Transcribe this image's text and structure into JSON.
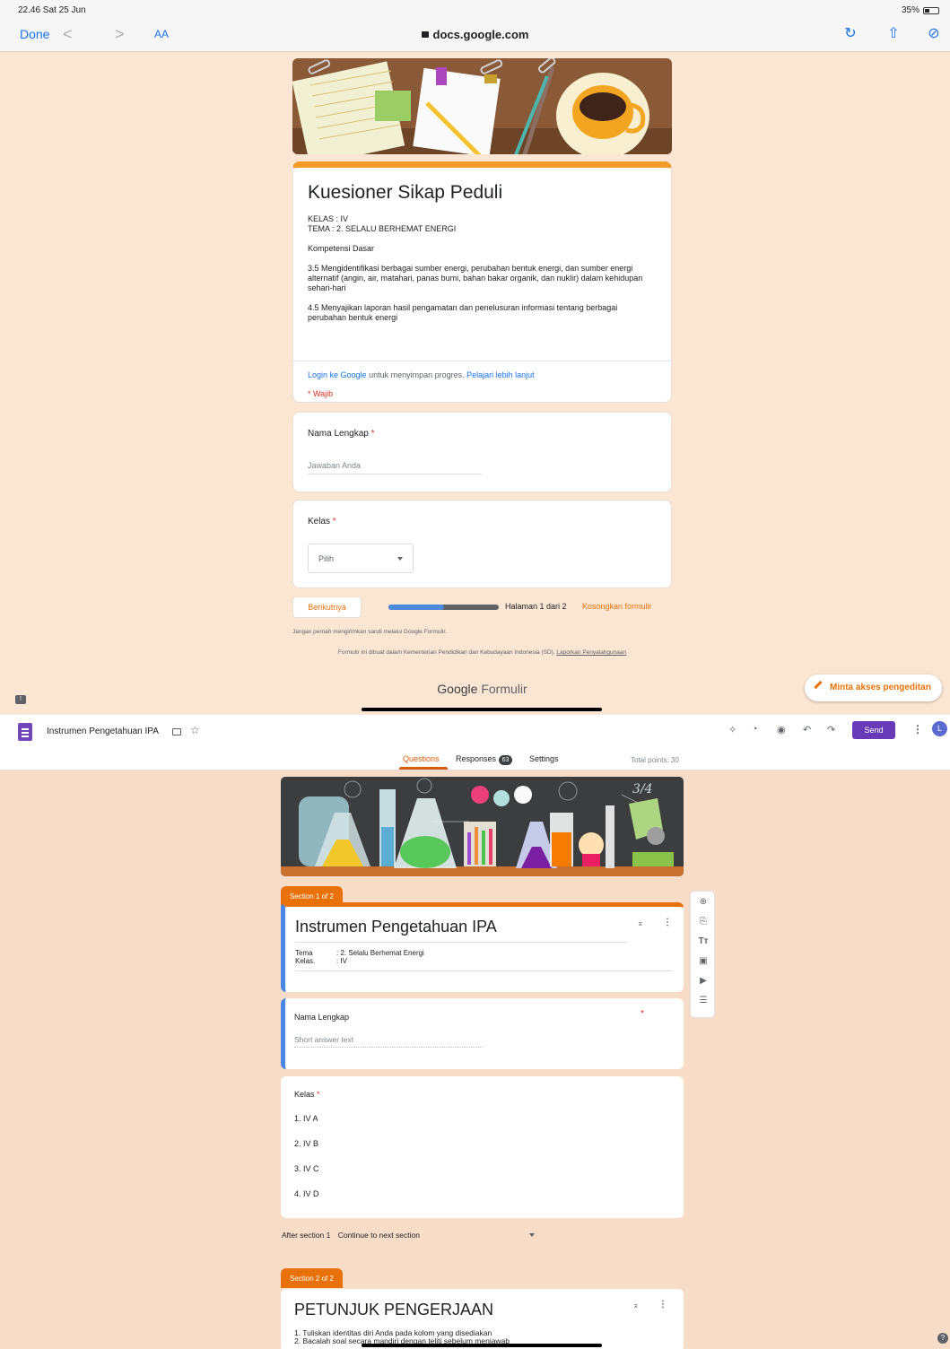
{
  "status_bar": {
    "time": "22.46  Sat 25 Jun",
    "battery": "35%"
  },
  "browser": {
    "done_label": "Done",
    "back": "<",
    "forward": ">",
    "text_size": "AA",
    "url": "docs.google.com"
  },
  "form": {
    "title": "Kuesioner Sikap Peduli",
    "description": "KELAS : IV\nTEMA  : 2. SELALU BERHEMAT ENERGI\n\nKompetensi Dasar\n\n3.5 Mengidentifikasi berbagai sumber energi, perubahan bentuk energi, dan sumber energi alternatif (angin, air, matahari, panas bumi, bahan bakar organik, dan nuklir) dalam kehidupan sehari-hari\n\n4.5  Menyajikan laporan hasil pengamatan dan penelusuran informasi tentang berbagai perubahan bentuk energi",
    "login_link": "Login ke Google",
    "login_text": " untuk menyimpan progres. ",
    "learn_more": "Pelajari lebih lanjut",
    "required_note": "* Wajib",
    "questions": [
      {
        "label": "Nama Lengkap",
        "required_mark": "*",
        "placeholder": "Jawaban Anda"
      },
      {
        "label": "Kelas",
        "required_mark": "*",
        "select_value": "Pilih"
      }
    ],
    "next_button": "Berikutnya",
    "progress_fraction": 0.5,
    "page_text": "Halaman 1 dari 2",
    "clear_form": "Kosongkan formulir",
    "footnote_password": "Jangan pernah mengirimkan sandi melalui Google Formulir.",
    "footnote_org": "Formulir ini dibuat dalam Kementerian Pendidikan dan Kebudayaan Indonesia (SD). ",
    "footnote_report": "Laporkan Penyalahgunaan",
    "brand_google": "Google",
    "brand_formulir": " Formulir",
    "edit_access": "Minta akses pengeditan"
  },
  "editor": {
    "doc_title": "Instrumen Pengetahuan IPA",
    "send_label": "Send",
    "avatar_initial": "L",
    "tabs": {
      "questions": "Questions",
      "responses": "Responses",
      "responses_count": "63",
      "settings": "Settings"
    },
    "total_points": "Total points: 30",
    "section1_tab": "Section 1 of 2",
    "section_title": "Instrumen Pengetahuan IPA",
    "meta_tema_label": "Tema",
    "meta_tema_value": ": 2. Selalu Berhemat Energi",
    "meta_kelas_label": "Kelas.",
    "meta_kelas_value": ": IV",
    "q1_label": "Nama Lengkap",
    "q1_star": "*",
    "q1_answer": "Short answer text",
    "q2_label": "Kelas",
    "q2_star": "*",
    "q2_options": [
      "1.  IV A",
      "2.  IV B",
      "3.  IV C",
      "4.  IV D"
    ],
    "after_section": "After section 1",
    "after_section_action": "Continue to next section",
    "section2_tab": "Section 2 of 2",
    "section2_title": "PETUNJUK PENGERJAAN",
    "section2_lines": [
      "1.   Tuliskan identitas diri Anda pada kolom yang disediakan",
      "2.   Bacalah soal secara mandiri dengan teliti sebelum menjawab"
    ]
  },
  "colors": {
    "accent_orange": "#e8710a",
    "forms_purple": "#673ab7",
    "link_blue": "#1a73e8",
    "bg_peach": "#f7dcc7"
  }
}
